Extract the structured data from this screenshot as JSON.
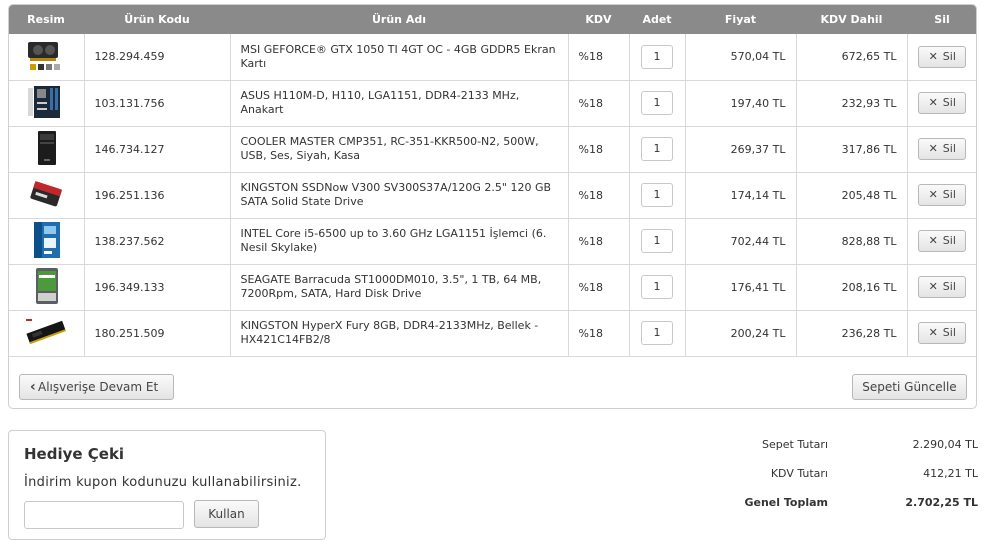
{
  "table": {
    "headers": {
      "image": "Resim",
      "code": "Ürün Kodu",
      "name": "Ürün Adı",
      "vat": "KDV",
      "qty": "Adet",
      "price": "Fiyat",
      "vat_incl": "KDV Dahil",
      "delete": "Sil"
    },
    "rows": [
      {
        "code": "128.294.459",
        "name": "MSI GEFORCE® GTX 1050 TI 4GT OC - 4GB GDDR5 Ekran Kartı",
        "vat": "%18",
        "qty": "1",
        "price": "570,04 TL",
        "vat_incl": "672,65 TL",
        "delete_label": "Sil",
        "icon": "graphics-card-icon"
      },
      {
        "code": "103.131.756",
        "name": "ASUS H110M-D, H110, LGA1151, DDR4-2133 MHz, Anakart",
        "vat": "%18",
        "qty": "1",
        "price": "197,40 TL",
        "vat_incl": "232,93 TL",
        "delete_label": "Sil",
        "icon": "motherboard-icon"
      },
      {
        "code": "146.734.127",
        "name": "COOLER MASTER CMP351, RC-351-KKR500-N2, 500W, USB, Ses, Siyah, Kasa",
        "vat": "%18",
        "qty": "1",
        "price": "269,37 TL",
        "vat_incl": "317,86 TL",
        "delete_label": "Sil",
        "icon": "pc-case-icon"
      },
      {
        "code": "196.251.136",
        "name": "KINGSTON SSDNow V300 SV300S37A/120G 2.5\" 120 GB SATA Solid State Drive",
        "vat": "%18",
        "qty": "1",
        "price": "174,14 TL",
        "vat_incl": "205,48 TL",
        "delete_label": "Sil",
        "icon": "ssd-icon"
      },
      {
        "code": "138.237.562",
        "name": "INTEL Core i5-6500 up to 3.60 GHz LGA1151 İşlemci (6. Nesil Skylake)",
        "vat": "%18",
        "qty": "1",
        "price": "702,44 TL",
        "vat_incl": "828,88 TL",
        "delete_label": "Sil",
        "icon": "cpu-box-icon"
      },
      {
        "code": "196.349.133",
        "name": "SEAGATE Barracuda ST1000DM010, 3.5\", 1 TB, 64 MB, 7200Rpm, SATA, Hard Disk Drive",
        "vat": "%18",
        "qty": "1",
        "price": "176,41 TL",
        "vat_incl": "208,16 TL",
        "delete_label": "Sil",
        "icon": "hard-disk-icon"
      },
      {
        "code": "180.251.509",
        "name": "KINGSTON HyperX Fury 8GB, DDR4-2133MHz, Bellek - HX421C14FB2/8",
        "vat": "%18",
        "qty": "1",
        "price": "200,24 TL",
        "vat_incl": "236,28 TL",
        "delete_label": "Sil",
        "icon": "ram-module-icon"
      }
    ]
  },
  "actions": {
    "continue_label": "Alışverişe Devam Et",
    "update_label": "Sepeti Güncelle"
  },
  "gift": {
    "title": "Hediye Çeki",
    "description": "İndirim kupon kodunuzu kullanabilirsiniz.",
    "coupon_value": "",
    "use_label": "Kullan"
  },
  "totals": {
    "subtotal_label": "Sepet Tutarı",
    "subtotal_value": "2.290,04 TL",
    "vat_label": "KDV Tutarı",
    "vat_value": "412,21 TL",
    "grand_label": "Genel Toplam",
    "grand_value": "2.702,25 TL"
  },
  "colors": {
    "header_bg": "#8a8a8a",
    "link": "#3a6fa6"
  }
}
